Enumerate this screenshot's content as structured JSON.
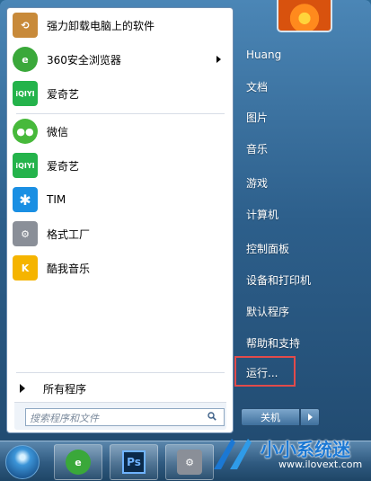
{
  "pinned": [
    {
      "label": "强力卸载电脑上的软件",
      "icon": "uninstall-box-icon",
      "color": "#c88a3a"
    },
    {
      "label": "360安全浏览器",
      "icon": "browser-360-icon",
      "color": "#3aa83a",
      "has_submenu": true
    },
    {
      "label": "爱奇艺",
      "icon": "iqiyi-icon",
      "color": "#24b34b",
      "icon_text": "iQIYI"
    }
  ],
  "recent": [
    {
      "label": "微信",
      "icon": "wechat-icon",
      "color": "#47b93b"
    },
    {
      "label": "爱奇艺",
      "icon": "iqiyi-icon",
      "color": "#24b34b",
      "icon_text": "iQIYI"
    },
    {
      "label": "TIM",
      "icon": "tim-icon",
      "color": "#1a8fe3",
      "icon_text": "✱"
    },
    {
      "label": "格式工厂",
      "icon": "format-factory-icon",
      "color": "#8a8f98"
    },
    {
      "label": "酷我音乐",
      "icon": "kuwo-music-icon",
      "color": "#f5b400",
      "icon_text": "K"
    }
  ],
  "all_programs_label": "所有程序",
  "search": {
    "placeholder": "搜索程序和文件"
  },
  "right_items": [
    {
      "label": "Huang"
    },
    {
      "label": "文档"
    },
    {
      "label": "图片"
    },
    {
      "label": "音乐"
    },
    {
      "label": "游戏"
    },
    {
      "label": "计算机"
    },
    {
      "label": "控制面板"
    },
    {
      "label": "设备和打印机"
    },
    {
      "label": "默认程序"
    },
    {
      "label": "帮助和支持"
    },
    {
      "label": "运行..."
    }
  ],
  "shutdown_label": "关机",
  "highlight_color": "#e24b4b",
  "taskbar": [
    {
      "name": "start-orb"
    },
    {
      "name": "360-browser",
      "icon": "browser-360-icon"
    },
    {
      "name": "photoshop",
      "icon": "photoshop-icon",
      "text": "Ps"
    },
    {
      "name": "format-factory",
      "icon": "format-factory-icon"
    }
  ],
  "watermark": {
    "text": "小小系统迷",
    "url": "www.ilovext.com"
  }
}
